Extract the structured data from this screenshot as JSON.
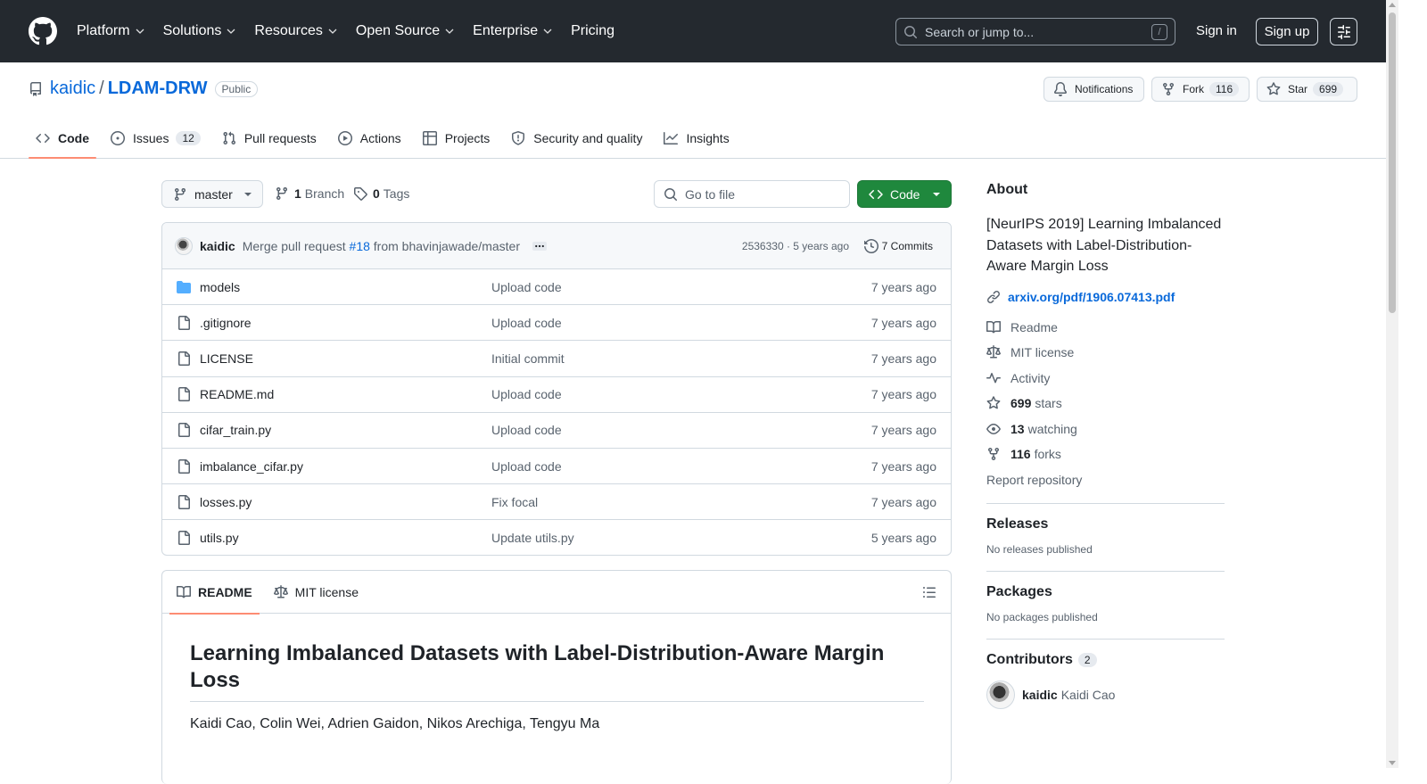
{
  "header": {
    "nav": [
      {
        "label": "Platform"
      },
      {
        "label": "Solutions"
      },
      {
        "label": "Resources"
      },
      {
        "label": "Open Source"
      },
      {
        "label": "Enterprise"
      },
      {
        "label": "Pricing"
      }
    ],
    "search_placeholder": "Search or jump to...",
    "search_kbd": "/",
    "signin": "Sign in",
    "signup": "Sign up"
  },
  "repo": {
    "owner": "kaidic",
    "slash": "/",
    "name": "LDAM-DRW",
    "visibility": "Public",
    "notifications_label": "Notifications",
    "fork_label": "Fork",
    "fork_count": "116",
    "star_label": "Star",
    "star_count": "699"
  },
  "tabs": [
    {
      "label": "Code"
    },
    {
      "label": "Issues",
      "count": "12"
    },
    {
      "label": "Pull requests"
    },
    {
      "label": "Actions"
    },
    {
      "label": "Projects"
    },
    {
      "label": "Security and quality"
    },
    {
      "label": "Insights"
    }
  ],
  "toolbar": {
    "branch": "master",
    "branches_count": "1",
    "branches_label": "Branch",
    "tags_count": "0",
    "tags_label": "Tags",
    "goto_placeholder": "Go to file",
    "code_button": "Code"
  },
  "latest_commit": {
    "author": "kaidic",
    "message_prefix": "Merge pull request",
    "pr": "#18",
    "message_suffix": "from bhavinjawade/master",
    "meta": "2536330 · 5 years ago",
    "commits_label": "7 Commits"
  },
  "files": [
    {
      "name": "models",
      "type": "folder",
      "commit": "Upload code",
      "age": "7 years ago"
    },
    {
      "name": ".gitignore",
      "type": "file",
      "commit": "Upload code",
      "age": "7 years ago"
    },
    {
      "name": "LICENSE",
      "type": "file",
      "commit": "Initial commit",
      "age": "7 years ago"
    },
    {
      "name": "README.md",
      "type": "file",
      "commit": "Upload code",
      "age": "7 years ago"
    },
    {
      "name": "cifar_train.py",
      "type": "file",
      "commit": "Upload code",
      "age": "7 years ago"
    },
    {
      "name": "imbalance_cifar.py",
      "type": "file",
      "commit": "Upload code",
      "age": "7 years ago"
    },
    {
      "name": "losses.py",
      "type": "file",
      "commit": "Fix focal",
      "age": "7 years ago"
    },
    {
      "name": "utils.py",
      "type": "file",
      "commit": "Update utils.py",
      "age": "5 years ago"
    }
  ],
  "readme": {
    "tab_readme": "README",
    "tab_license": "MIT license",
    "title": "Learning Imbalanced Datasets with Label-Distribution-Aware Margin Loss",
    "authors": "Kaidi Cao, Colin Wei, Adrien Gaidon, Nikos Arechiga, Tengyu Ma"
  },
  "about": {
    "heading": "About",
    "description": "[NeurIPS 2019] Learning Imbalanced Datasets with Label-Distribution-Aware Margin Loss",
    "link": "arxiv.org/pdf/1906.07413.pdf",
    "readme": "Readme",
    "license": "MIT license",
    "activity": "Activity",
    "stars_count": "699",
    "stars_label": "stars",
    "watching_count": "13",
    "watching_label": "watching",
    "forks_count": "116",
    "forks_label": "forks",
    "report": "Report repository"
  },
  "releases": {
    "heading": "Releases",
    "empty": "No releases published"
  },
  "packages": {
    "heading": "Packages",
    "empty": "No packages published"
  },
  "contributors": {
    "heading": "Contributors",
    "count": "2",
    "list": [
      {
        "login": "kaidic",
        "name": "Kaidi Cao"
      }
    ]
  },
  "colors": {
    "header_bg": "#24292f",
    "link": "#0969da",
    "code_button": "#1f883d",
    "active_tab_underline": "#fd8c73",
    "folder_icon": "#54aeff"
  }
}
